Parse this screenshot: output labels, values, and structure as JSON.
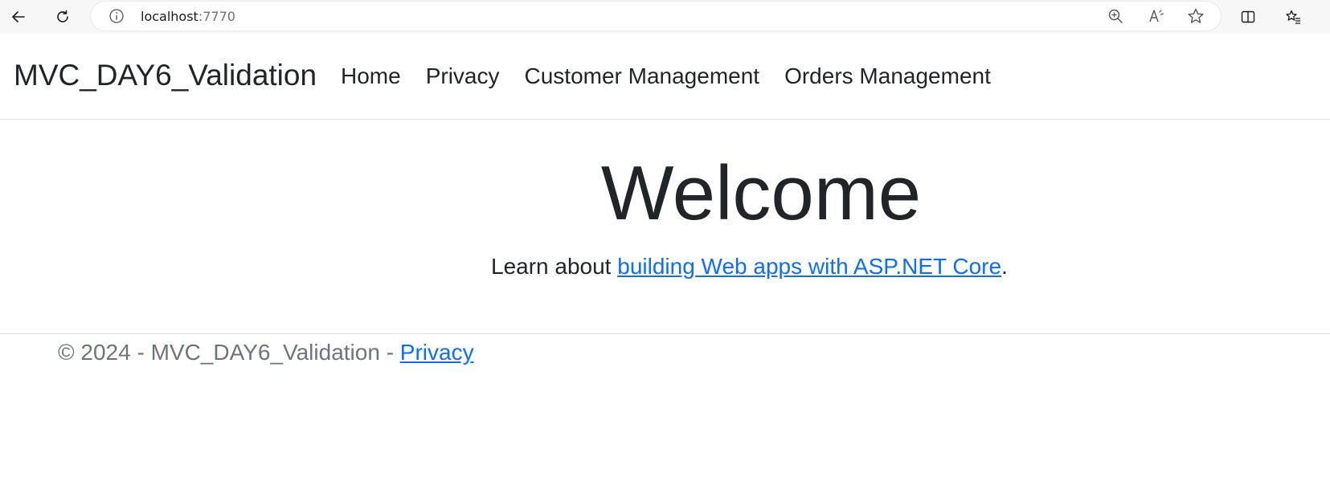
{
  "browser": {
    "url_host": "localhost",
    "url_port": ":7770",
    "icons": [
      "back-icon",
      "refresh-icon",
      "info-icon",
      "zoom-icon",
      "read-aloud-icon",
      "favorite-star-icon",
      "split-screen-icon",
      "favorites-list-icon"
    ]
  },
  "navbar": {
    "brand": "MVC_DAY6_Validation",
    "links": [
      {
        "label": "Home"
      },
      {
        "label": "Privacy"
      },
      {
        "label": "Customer Management"
      },
      {
        "label": "Orders Management"
      }
    ]
  },
  "main": {
    "heading": "Welcome",
    "learn_prefix": "Learn about ",
    "learn_link": "building Web apps with ASP.NET Core",
    "learn_suffix": "."
  },
  "footer": {
    "text": "© 2024 - MVC_DAY6_Validation - ",
    "privacy_link": "Privacy"
  },
  "colors": {
    "link": "#0d6efd",
    "text": "#212529",
    "muted": "#6c757d"
  }
}
